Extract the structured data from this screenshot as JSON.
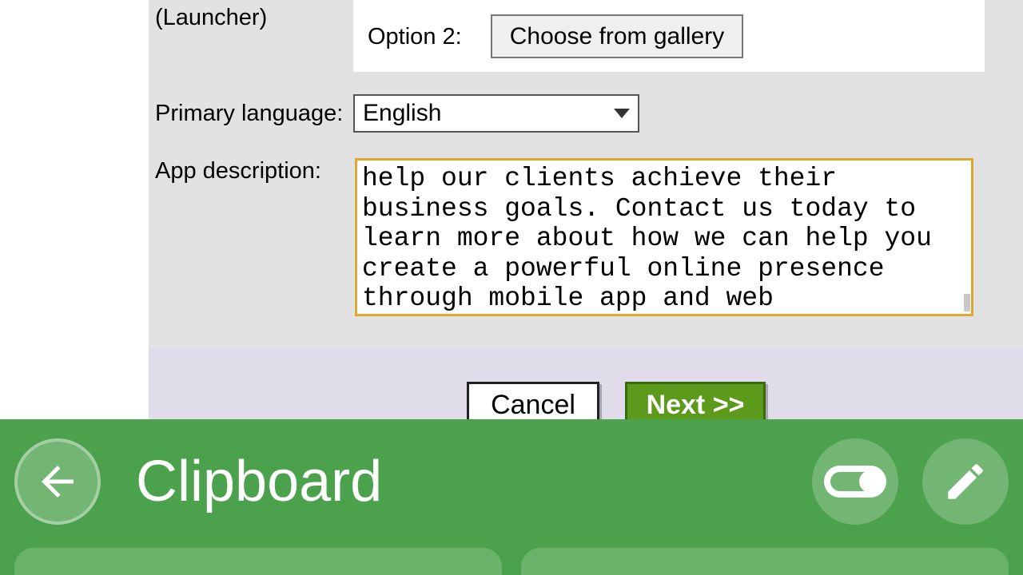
{
  "form": {
    "launcher_label": "(Launcher)",
    "option2_label": "Option 2:",
    "gallery_button": "Choose from gallery",
    "language_label": "Primary language:",
    "language_value": "English",
    "description_label": "App description:",
    "description_value": "help our clients achieve their business goals. Contact us today to learn more about how we can help you create a powerful online presence through mobile app and web development."
  },
  "buttons": {
    "cancel": "Cancel",
    "next": "Next >>"
  },
  "clipboard": {
    "title": "Clipboard"
  }
}
